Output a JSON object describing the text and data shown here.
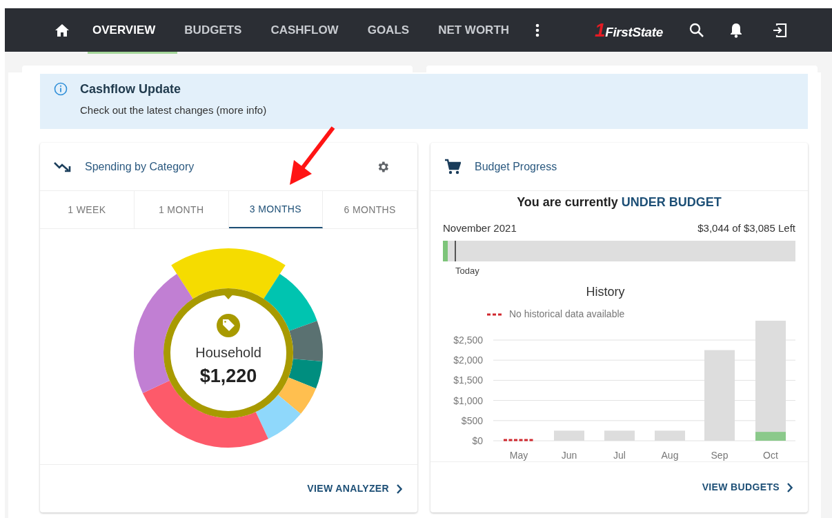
{
  "nav": {
    "items": [
      {
        "label": "OVERVIEW",
        "selected": true
      },
      {
        "label": "BUDGETS",
        "selected": false
      },
      {
        "label": "CASHFLOW",
        "selected": false
      },
      {
        "label": "GOALS",
        "selected": false
      },
      {
        "label": "NET WORTH",
        "selected": false
      }
    ],
    "logo": {
      "mark": "1",
      "name": "FirstState"
    }
  },
  "banner": {
    "title": "Cashflow Update",
    "text": "Check out the latest changes (more info)"
  },
  "spending_card": {
    "title": "Spending by Category",
    "tabs": [
      {
        "label": "1 WEEK",
        "selected": false
      },
      {
        "label": "1 MONTH",
        "selected": false
      },
      {
        "label": "3 MONTHS",
        "selected": true
      },
      {
        "label": "6 MONTHS",
        "selected": false
      }
    ],
    "center_label": "Household",
    "center_amount": "$1,220",
    "action": "VIEW ANALYZER"
  },
  "budget_card": {
    "title": "Budget Progress",
    "status_prefix": "You are currently",
    "status_value": "UNDER BUDGET",
    "month": "November 2021",
    "remaining": "$3,044 of $3,085 Left",
    "progress": {
      "level": 0.013
    },
    "today_label": "Today",
    "legend": "No historical data available",
    "chart_data": {
      "type": "bar",
      "title": "History",
      "categories": [
        "May",
        "Jun",
        "Jul",
        "Aug",
        "Sep",
        "Oct"
      ],
      "series": [
        {
          "color": "#dddddd",
          "values": [
            null,
            250,
            250,
            250,
            2250,
            2980
          ]
        },
        {
          "color": "#8bc98b",
          "values": [
            null,
            0,
            0,
            0,
            0,
            220
          ]
        }
      ],
      "ylim": [
        0,
        3000
      ],
      "grid": true,
      "yticks": [
        {
          "value": 0,
          "label": "$0"
        },
        {
          "value": 500,
          "label": "$500"
        },
        {
          "value": 1000,
          "label": "$1,000"
        },
        {
          "value": 1500,
          "label": "$1,500"
        },
        {
          "value": 2000,
          "label": "$2,000"
        },
        {
          "value": 2500,
          "label": "$2,500"
        }
      ]
    },
    "action": "VIEW BUDGETS"
  }
}
